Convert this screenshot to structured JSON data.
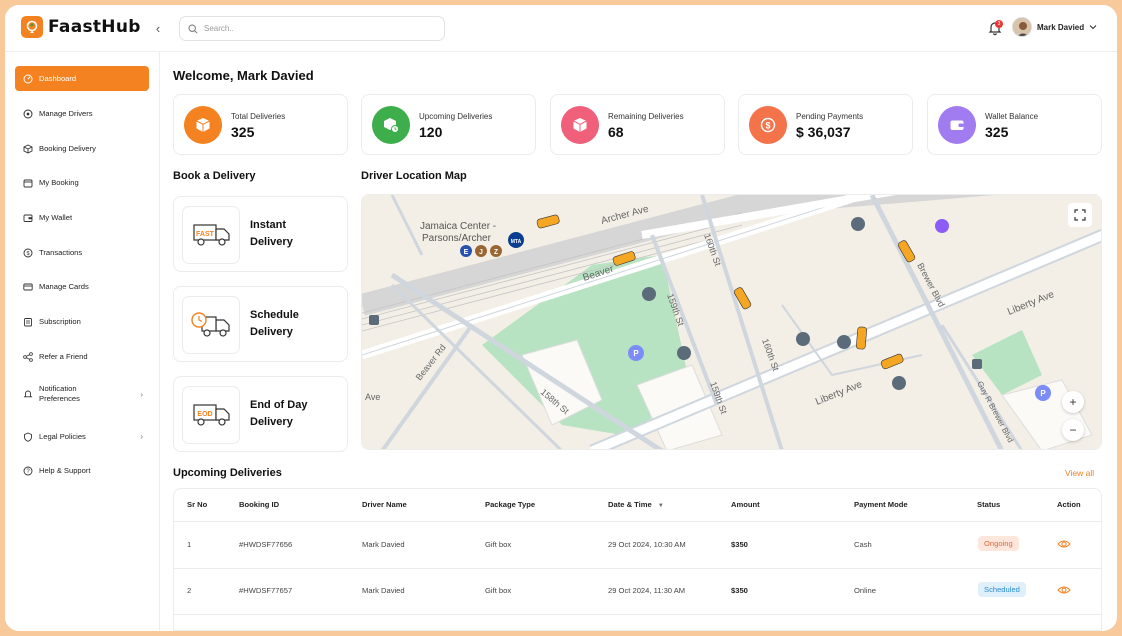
{
  "app": {
    "name": "FaastHub",
    "accent": "#f58220"
  },
  "search": {
    "placeholder": "Search.."
  },
  "header": {
    "notifications_count": "3",
    "user_name": "Mark Davied"
  },
  "sidebar": {
    "items": [
      {
        "label": "Dashboard",
        "icon": "dashboard-icon"
      },
      {
        "label": "Manage Drivers",
        "icon": "drivers-icon"
      },
      {
        "label": "Booking Delivery",
        "icon": "box-icon"
      },
      {
        "label": "My Booking",
        "icon": "calendar-icon"
      },
      {
        "label": "My Wallet",
        "icon": "wallet-icon"
      },
      {
        "label": "Transactions",
        "icon": "dollar-icon"
      },
      {
        "label": "Manage Cards",
        "icon": "card-icon"
      },
      {
        "label": "Subscription",
        "icon": "subscription-icon"
      },
      {
        "label": "Refer a Friend",
        "icon": "share-icon"
      },
      {
        "label": "Notification Preferences",
        "icon": "bell-icon"
      },
      {
        "label": "Legal Policies",
        "icon": "shield-icon"
      },
      {
        "label": "Help & Support",
        "icon": "help-icon"
      }
    ]
  },
  "main": {
    "welcome": "Welcome, Mark Davied",
    "stats": [
      {
        "label": "Total Deliveries",
        "value": "325",
        "color": "#f58220"
      },
      {
        "label": "Upcoming Deliveries",
        "value": "120",
        "color": "#3dae4b"
      },
      {
        "label": "Remaining Deliveries",
        "value": "68",
        "color": "#f0607a"
      },
      {
        "label": "Pending Payments",
        "value": "$ 36,037",
        "color": "#f4734a"
      },
      {
        "label": "Wallet Balance",
        "value": "325",
        "color": "#a07cf0"
      }
    ],
    "book_title": "Book a Delivery",
    "book_options": [
      {
        "line1": "Instant",
        "line2": "Delivery",
        "tag": "FAST"
      },
      {
        "line1": "Schedule",
        "line2": "Delivery",
        "tag": ""
      },
      {
        "line1": "End of Day",
        "line2": "Delivery",
        "tag": "EOD"
      }
    ],
    "map_title": "Driver Location Map",
    "map_labels": {
      "jamaica1": "Jamaica Center -",
      "jamaica2": "Parsons/Archer",
      "archer": "Archer Ave",
      "beaver": "Beaver",
      "beaver_rd": "Beaver Rd",
      "st160a": "160th St",
      "st160b": "160th St",
      "st159a": "159th St",
      "st159b": "159th St",
      "st158": "158th St",
      "liberty1": "Liberty Ave",
      "liberty2": "Liberty Ave",
      "brewer": "Brewer Blvd",
      "guy": "Guy R Brewer Blvd",
      "ave_left": "Ave",
      "subway_e": "E",
      "subway_j": "J",
      "subway_z": "Z",
      "mta": "MTA",
      "parking": "P"
    },
    "upcoming_title": "Upcoming Deliveries",
    "view_all": "View all",
    "table": {
      "headers": [
        "Sr No",
        "Booking ID",
        "Driver Name",
        "Package Type",
        "Date & Time",
        "Amount",
        "Payment Mode",
        "Status",
        "Action"
      ],
      "rows": [
        {
          "sr": "1",
          "id": "#HWDSF77656",
          "driver": "Mark Davied",
          "package": "Gift box",
          "datetime": "29 Oct 2024, 10:30 AM",
          "amount": "$350",
          "mode": "Cash",
          "status": "Ongoing"
        },
        {
          "sr": "2",
          "id": "#HWDSF77657",
          "driver": "Mark Davied",
          "package": "Gift box",
          "datetime": "29 Oct 2024, 11:30 AM",
          "amount": "$350",
          "mode": "Online",
          "status": "Scheduled"
        }
      ]
    }
  }
}
